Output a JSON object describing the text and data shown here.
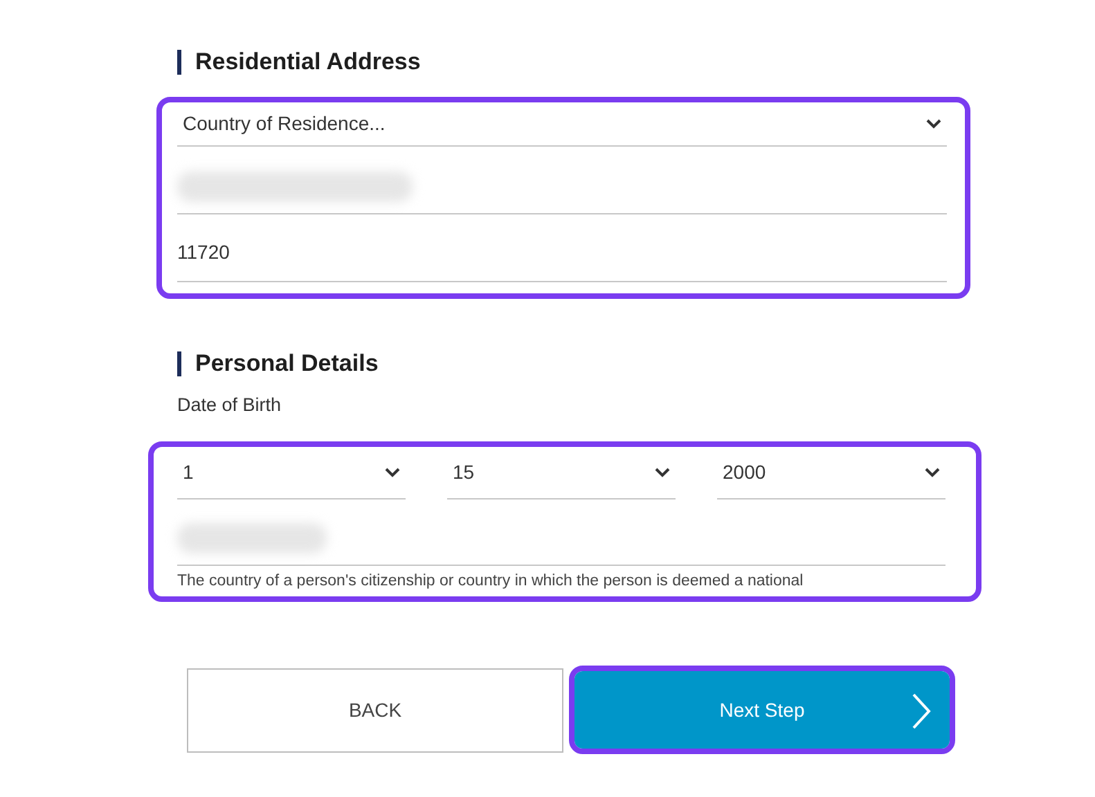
{
  "sections": [
    {
      "title": "Residential Address",
      "highlighted": true,
      "rows": [
        {
          "kind": "select",
          "value": "Country of Residence..."
        },
        {
          "kind": "blurred"
        },
        {
          "kind": "text",
          "value": "11720"
        }
      ]
    },
    {
      "title": "Personal Details",
      "label": "Date of Birth",
      "highlighted": true,
      "rows": [
        {
          "kind": "selects",
          "items": [
            {
              "value": "1"
            },
            {
              "value": "15"
            },
            {
              "value": "2000"
            }
          ]
        },
        {
          "kind": "blurred",
          "hint": "The country of a person's citizenship or country in which the person is deemed a national"
        }
      ]
    }
  ],
  "buttons": [
    {
      "kind": "back",
      "label": "BACK",
      "highlighted": false
    },
    {
      "kind": "next",
      "label": "Next Step",
      "highlighted": true
    }
  ]
}
